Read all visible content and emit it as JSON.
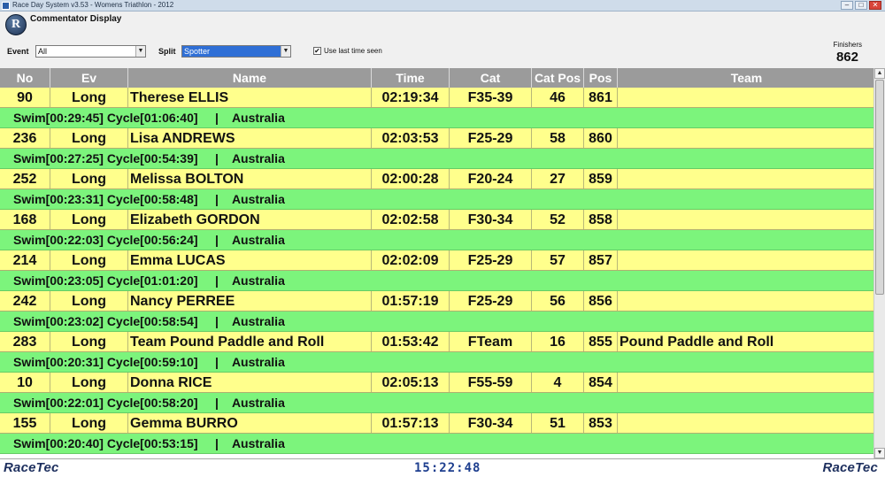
{
  "window": {
    "title": "Race Day System v3.53 - Womens Triathlon - 2012"
  },
  "header": {
    "logo_letter": "R",
    "title": "Commentator Display",
    "event_label": "Event",
    "event_value": "All",
    "split_label": "Split",
    "split_value": "Spotter",
    "use_last_time_label": "Use last time seen",
    "use_last_time_checked": "✔",
    "finishers_label": "Finishers",
    "finishers_value": "862"
  },
  "table": {
    "columns": [
      "No",
      "Ev",
      "Name",
      "Time",
      "Cat",
      "Cat Pos",
      "Pos",
      "Team"
    ],
    "rows": [
      {
        "no": "90",
        "ev": "Long",
        "name": "Therese ELLIS",
        "time": "02:19:34",
        "cat": "F35-39",
        "cat_pos": "46",
        "pos": "861",
        "team": "",
        "split": "Swim[00:29:45] Cycle[01:06:40]     |    Australia"
      },
      {
        "no": "236",
        "ev": "Long",
        "name": "Lisa ANDREWS",
        "time": "02:03:53",
        "cat": "F25-29",
        "cat_pos": "58",
        "pos": "860",
        "team": "",
        "split": "Swim[00:27:25] Cycle[00:54:39]     |    Australia"
      },
      {
        "no": "252",
        "ev": "Long",
        "name": "Melissa BOLTON",
        "time": "02:00:28",
        "cat": "F20-24",
        "cat_pos": "27",
        "pos": "859",
        "team": "",
        "split": "Swim[00:23:31] Cycle[00:58:48]     |    Australia"
      },
      {
        "no": "168",
        "ev": "Long",
        "name": "Elizabeth GORDON",
        "time": "02:02:58",
        "cat": "F30-34",
        "cat_pos": "52",
        "pos": "858",
        "team": "",
        "split": "Swim[00:22:03] Cycle[00:56:24]     |    Australia"
      },
      {
        "no": "214",
        "ev": "Long",
        "name": "Emma LUCAS",
        "time": "02:02:09",
        "cat": "F25-29",
        "cat_pos": "57",
        "pos": "857",
        "team": "",
        "split": "Swim[00:23:05] Cycle[01:01:20]     |    Australia"
      },
      {
        "no": "242",
        "ev": "Long",
        "name": "Nancy PERREE",
        "time": "01:57:19",
        "cat": "F25-29",
        "cat_pos": "56",
        "pos": "856",
        "team": "",
        "split": "Swim[00:23:02] Cycle[00:58:54]     |    Australia"
      },
      {
        "no": "283",
        "ev": "Long",
        "name": "Team Pound Paddle and Roll",
        "time": "01:53:42",
        "cat": "FTeam",
        "cat_pos": "16",
        "pos": "855",
        "team": "Pound Paddle and Roll",
        "split": "Swim[00:20:31] Cycle[00:59:10]     |    Australia"
      },
      {
        "no": "10",
        "ev": "Long",
        "name": "Donna RICE",
        "time": "02:05:13",
        "cat": "F55-59",
        "cat_pos": "4",
        "pos": "854",
        "team": "",
        "split": "Swim[00:22:01] Cycle[00:58:20]     |    Australia"
      },
      {
        "no": "155",
        "ev": "Long",
        "name": "Gemma BURRO",
        "time": "01:57:13",
        "cat": "F30-34",
        "cat_pos": "51",
        "pos": "853",
        "team": "",
        "split": "Swim[00:20:40] Cycle[00:53:15]     |    Australia"
      }
    ]
  },
  "footer": {
    "brand_left": "RaceTec",
    "brand_right": "RaceTec",
    "clock": "15:22:48"
  },
  "colors": {
    "row_yellow": "#ffff8c",
    "split_green": "#7cf47c",
    "header_grey": "#9b9b9b",
    "brand_navy": "#1d2f5e"
  }
}
